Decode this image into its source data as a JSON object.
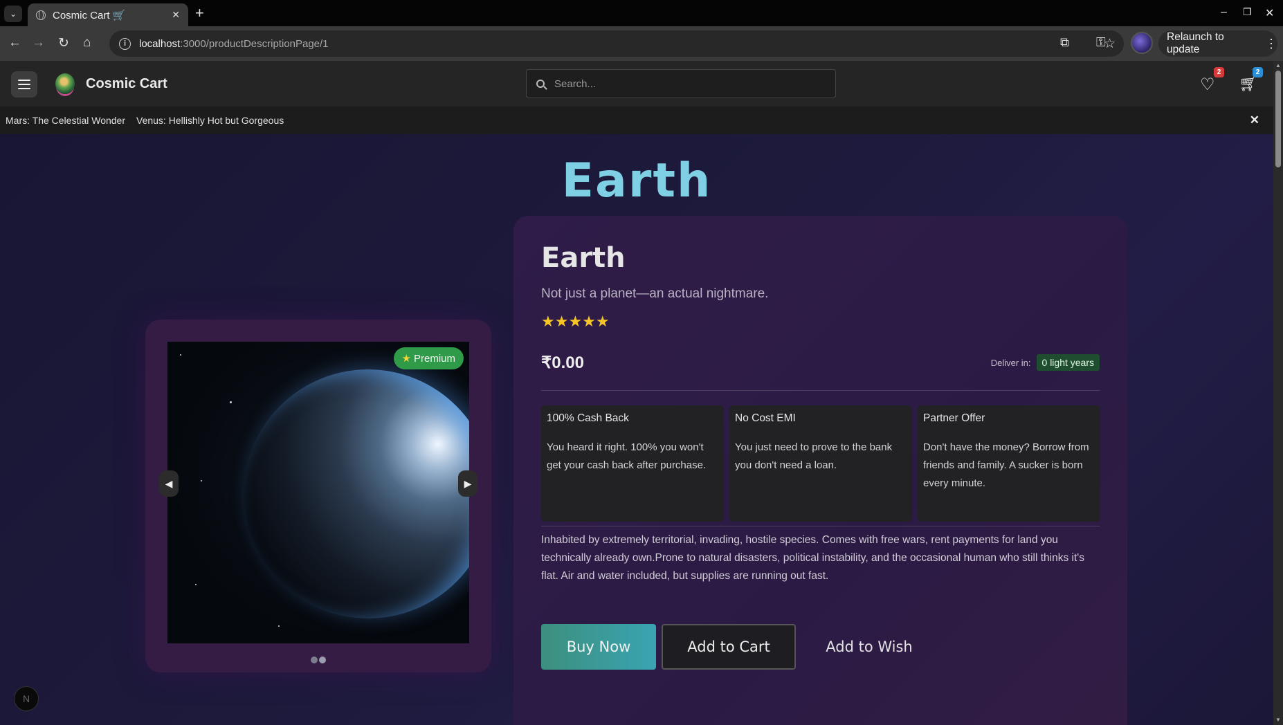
{
  "browser": {
    "tab_title": "Cosmic Cart 🛒",
    "url_host": "localhost",
    "url_path": ":3000/productDescriptionPage/1",
    "relaunch_label": "Relaunch to update"
  },
  "header": {
    "brand": "Cosmic Cart",
    "search_placeholder": "Search...",
    "wishlist_count": "2",
    "cart_count": "2"
  },
  "announcements": {
    "items": [
      "Mars: The Celestial Wonder",
      "Venus: Hellishly Hot but Gorgeous"
    ]
  },
  "page": {
    "hero_title": "Earth"
  },
  "gallery": {
    "badge": "Premium",
    "prev_label": "◀",
    "next_label": "▶",
    "slide_count": 2,
    "active_slide": 2
  },
  "product": {
    "name": "Earth",
    "tagline": "Not just a planet—an actual nightmare.",
    "rating": 5,
    "rating_max": 5,
    "stars": "★★★★★",
    "price": "₹0.00",
    "deliver_label": "Deliver in:",
    "deliver_value": "0 light years",
    "offers": [
      {
        "title": "100% Cash Back",
        "text": "You heard it right. 100% you won't get your cash back after purchase."
      },
      {
        "title": "No Cost EMI",
        "text": "You just need to prove to the bank you don't need a loan."
      },
      {
        "title": "Partner Offer",
        "text": "Don't have the money? Borrow from friends and family. A sucker is born every minute."
      }
    ],
    "description": "Inhabited by extremely territorial, invading, hostile species. Comes with free wars, rent payments for land you technically already own.Prone to natural disasters, political instability, and the occasional human who still thinks it's flat. Air and water included, but supplies are running out fast.",
    "buy_label": "Buy Now",
    "cart_label": "Add to Cart",
    "wish_label": "Add to Wish"
  },
  "dev_badge": "N",
  "colors": {
    "accent_title": "#7fd0e4",
    "premium_green": "#2f9a48",
    "star_yellow": "#f6c626",
    "buy_gradient_start": "#3c8f7d",
    "buy_gradient_end": "#3aa4b2"
  }
}
